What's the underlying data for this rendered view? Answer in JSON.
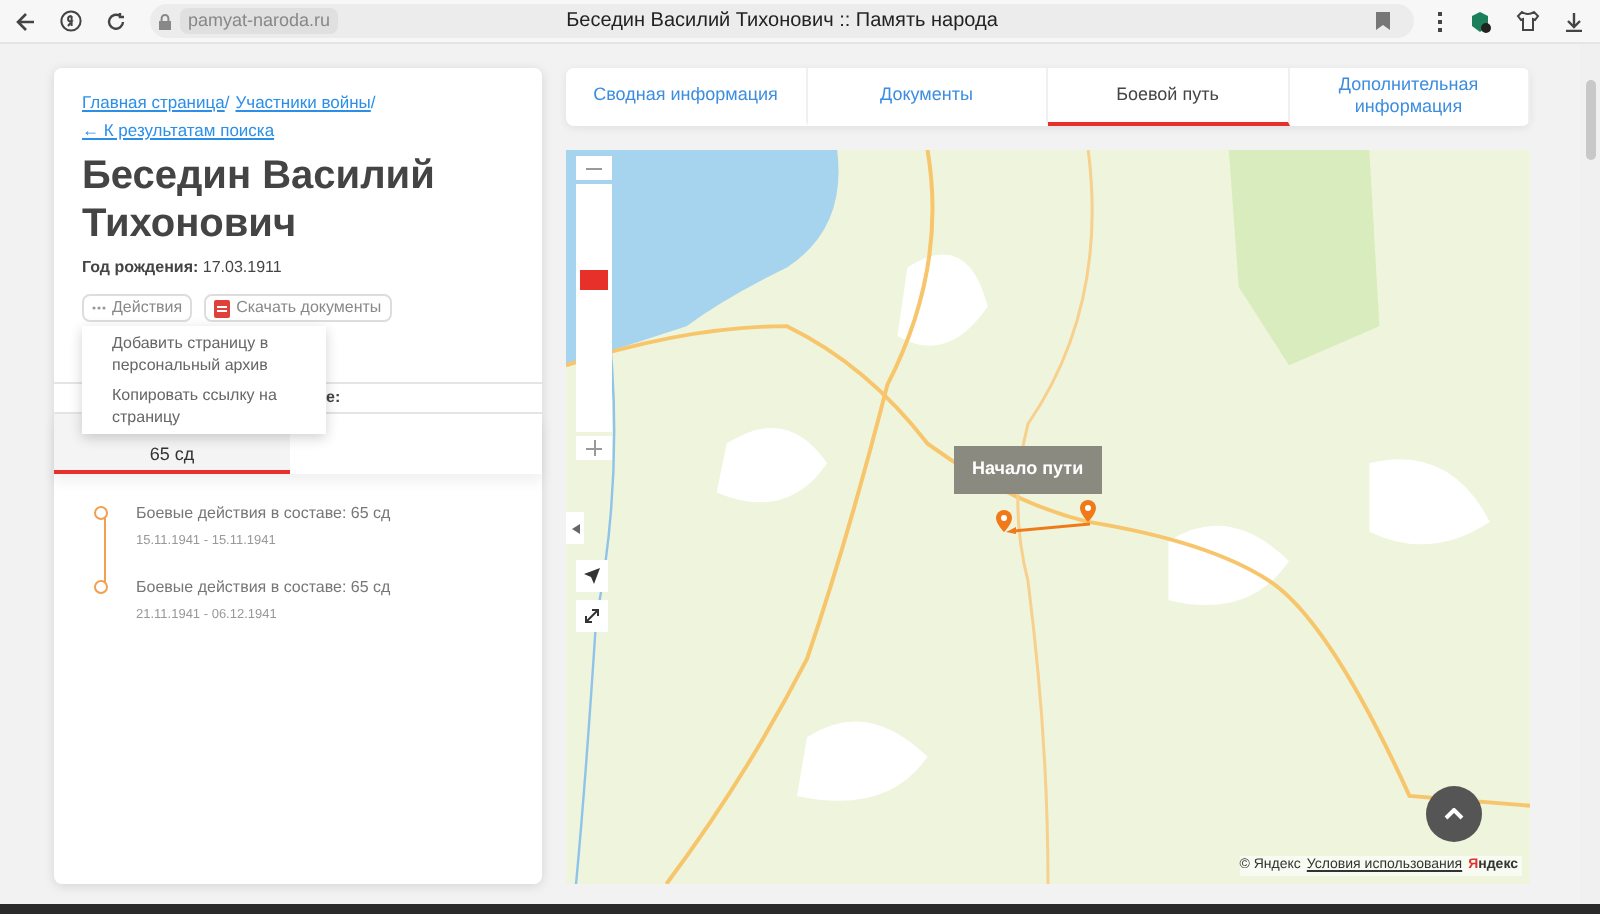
{
  "browser": {
    "address": "pamyat-naroda.ru",
    "title": "Беседин Василий Тихонович :: Память народа"
  },
  "breadcrumbs": [
    {
      "label": "Главная страница",
      "separator": "/"
    },
    {
      "label": "Участники войны",
      "separator": "/"
    }
  ],
  "back_link": "← К результатам поиска",
  "person": {
    "name": "Беседин Василий Тихонович",
    "birth_label": "Год рождения:",
    "birth_date": "17.03.1911"
  },
  "actions": [
    {
      "kind": "menu",
      "label": "Действия"
    },
    {
      "kind": "download",
      "label": "Скачать документы"
    }
  ],
  "actions_menu": {
    "items": [
      "Добавить страницу в персональный архив",
      "Копировать ссылку на страницу"
    ]
  },
  "hidden_heading_tail": "е:",
  "unit_tabs": [
    {
      "label": "65 сд",
      "selected": true
    }
  ],
  "timeline": [
    {
      "title": "Боевые действия в составе: 65 сд",
      "dates": "15.11.1941 - 15.11.1941"
    },
    {
      "title": "Боевые действия в составе: 65 сд",
      "dates": "21.11.1941 - 06.12.1941"
    }
  ],
  "tabs": [
    {
      "label": "Сводная информация",
      "selected": false
    },
    {
      "label": "Документы",
      "selected": false
    },
    {
      "label": "Боевой путь",
      "selected": true
    },
    {
      "label": "Дополнительная информация",
      "selected": false
    }
  ],
  "map": {
    "kind": "picture",
    "zoom": {
      "level": 0.625
    },
    "callout": "Начало пути",
    "copyright": "© Яндекс",
    "terms_link": "Условия использования",
    "logo": "Яндекс"
  }
}
